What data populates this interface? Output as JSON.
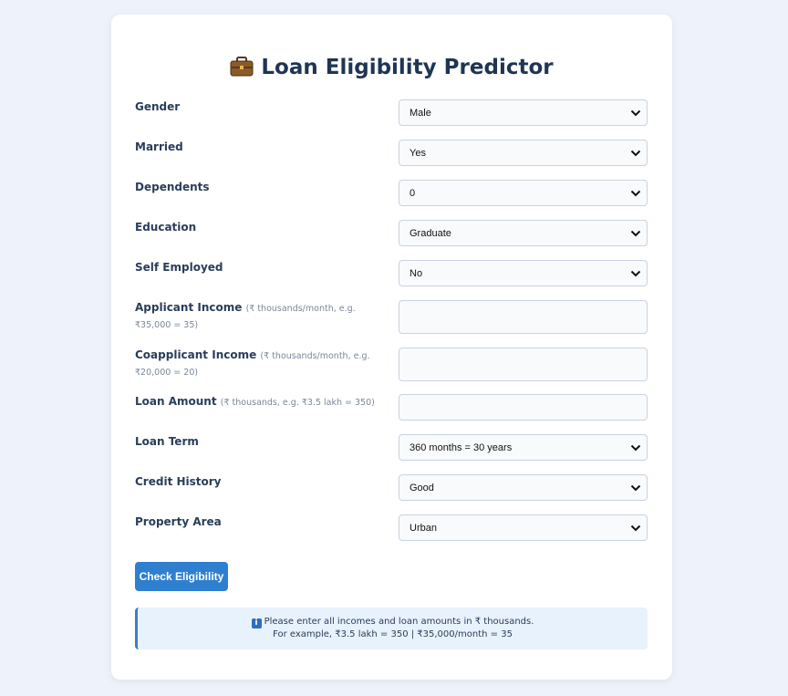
{
  "header": {
    "title": "Loan Eligibility Predictor",
    "icon": "briefcase-icon"
  },
  "form": {
    "gender": {
      "label": "Gender",
      "value": "Male"
    },
    "married": {
      "label": "Married",
      "value": "Yes"
    },
    "dependents": {
      "label": "Dependents",
      "value": "0"
    },
    "education": {
      "label": "Education",
      "value": "Graduate"
    },
    "self_employed": {
      "label": "Self Employed",
      "value": "No"
    },
    "applicant_income": {
      "label": "Applicant Income",
      "hint": "(₹ thousands/month, e.g. ₹35,000 = 35)",
      "value": ""
    },
    "coapplicant_income": {
      "label": "Coapplicant Income",
      "hint": "(₹ thousands/month, e.g. ₹20,000 = 20)",
      "value": ""
    },
    "loan_amount": {
      "label": "Loan Amount",
      "hint": "(₹ thousands, e.g. ₹3.5 lakh = 350)",
      "value": ""
    },
    "loan_term": {
      "label": "Loan Term",
      "value": "360 months = 30 years"
    },
    "credit_history": {
      "label": "Credit History",
      "value": "Good"
    },
    "property_area": {
      "label": "Property Area",
      "value": "Urban"
    }
  },
  "actions": {
    "check_label": "Check Eligibility"
  },
  "info": {
    "icon": "info-icon",
    "line1": "Please enter all incomes and loan amounts in ₹ thousands.",
    "line2": "For example, ₹3.5 lakh = 350 | ₹35,000/month = 35"
  },
  "colors": {
    "accent": "#2f7fd0",
    "title": "#1f3553",
    "background": "#eef3fb",
    "info_bg": "#e8f2fc"
  }
}
